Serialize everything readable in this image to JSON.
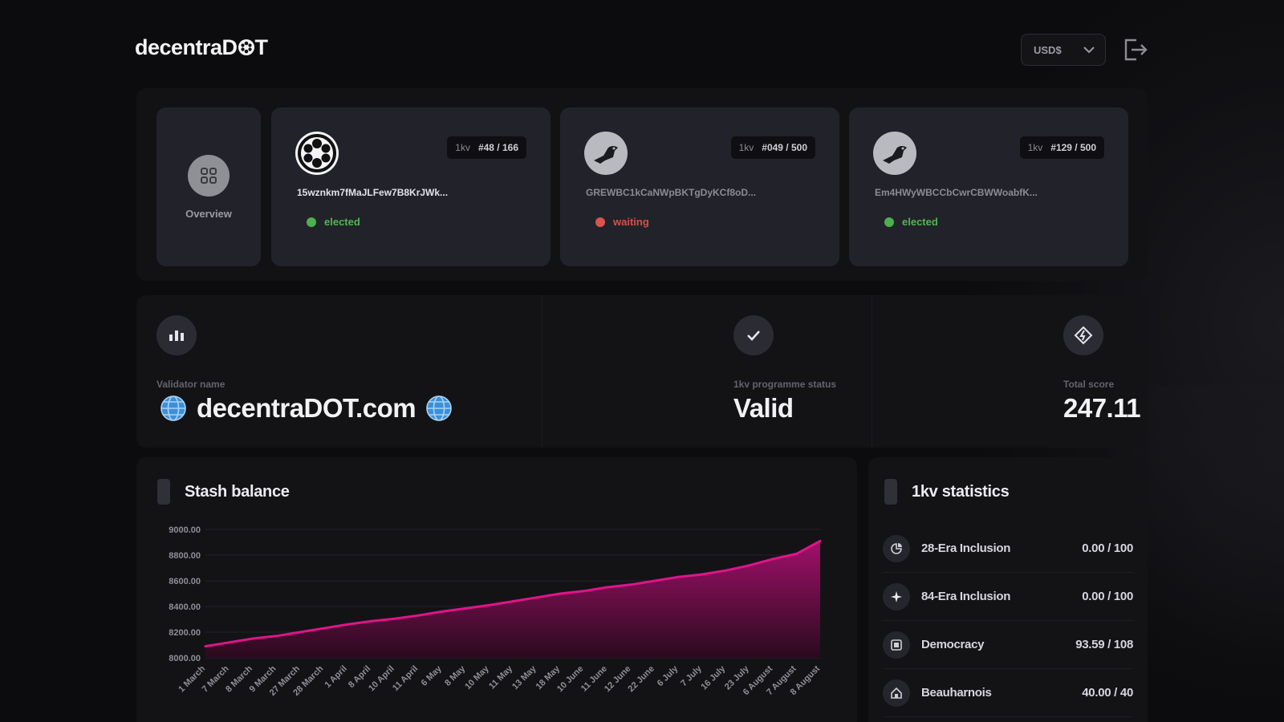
{
  "header": {
    "logo_text_a": "decentraD",
    "logo_text_b": "T",
    "currency": "USD$"
  },
  "overview": {
    "label": "Overview"
  },
  "validators": [
    {
      "badge_prefix": "1kv",
      "badge_rank": "#48 / 166",
      "address": "15wznkm7fMaJLFew7B8KrJWk...",
      "status": "elected"
    },
    {
      "badge_prefix": "1kv",
      "badge_rank": "#049 / 500",
      "address": "GREWBC1kCaNWpBKTgDyKCf8oD...",
      "status": "waiting"
    },
    {
      "badge_prefix": "1kv",
      "badge_rank": "#129 / 500",
      "address": "Em4HWyWBCCbCwrCBWWoabfK...",
      "status": "elected"
    }
  ],
  "info": {
    "validator_label": "Validator name",
    "validator_value": "decentraDOT.com",
    "programme_label": "1kv programme status",
    "programme_value": "Valid",
    "score_label": "Total score",
    "score_value": "247.11"
  },
  "stash": {
    "title": "Stash balance"
  },
  "chart_data": {
    "type": "area",
    "title": "Stash balance",
    "color": "#e0148a",
    "ylim": [
      8000,
      9000
    ],
    "y_ticks": [
      "9000.00",
      "8800.00",
      "8600.00",
      "8400.00",
      "8200.00",
      "8000.00"
    ],
    "categories": [
      "1 March",
      "7 March",
      "8 March",
      "9 March",
      "27 March",
      "28 March",
      "1 April",
      "8 April",
      "10 April",
      "11 April",
      "6 May",
      "8 May",
      "10 May",
      "11 May",
      "13 May",
      "18 May",
      "10 June",
      "11 June",
      "12 June",
      "22 June",
      "6 July",
      "7 July",
      "16 July",
      "23 July",
      "6 August",
      "7 August",
      "8 August"
    ],
    "values": [
      8090,
      8120,
      8150,
      8170,
      8200,
      8230,
      8260,
      8285,
      8305,
      8330,
      8360,
      8385,
      8410,
      8440,
      8470,
      8500,
      8520,
      8550,
      8570,
      8600,
      8630,
      8650,
      8680,
      8720,
      8770,
      8810,
      8910
    ]
  },
  "stats": {
    "title": "1kv statistics",
    "rows": [
      {
        "label": "28-Era Inclusion",
        "value": "0.00 / 100",
        "icon": "pie-icon"
      },
      {
        "label": "84-Era Inclusion",
        "value": "0.00 / 100",
        "icon": "sparkle-icon"
      },
      {
        "label": "Democracy",
        "value": "93.59 / 108",
        "icon": "ballot-icon"
      },
      {
        "label": "Beauharnois",
        "value": "40.00 / 40",
        "icon": "home-icon"
      }
    ]
  }
}
